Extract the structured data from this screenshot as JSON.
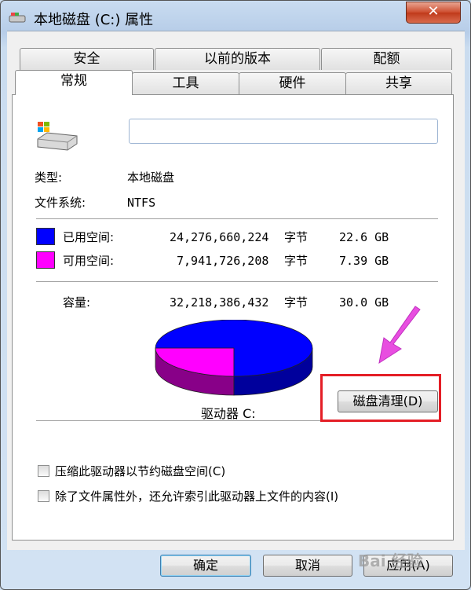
{
  "window": {
    "title": "本地磁盘 (C:) 属性",
    "close_label": "✕"
  },
  "tabs": {
    "row1": [
      "安全",
      "以前的版本",
      "配额"
    ],
    "row2": [
      "常规",
      "工具",
      "硬件",
      "共享"
    ],
    "selected": "常规"
  },
  "general": {
    "name_value": "",
    "type_label": "类型:",
    "type_value": "本地磁盘",
    "fs_label": "文件系统:",
    "fs_value": "NTFS",
    "used": {
      "label": "已用空间:",
      "bytes": "24,276,660,224",
      "unit": "字节",
      "size": "22.6 GB",
      "color": "#0000ff"
    },
    "free": {
      "label": "可用空间:",
      "bytes": "7,941,726,208",
      "unit": "字节",
      "size": "7.39 GB",
      "color": "#ff00ff"
    },
    "capacity": {
      "label": "容量:",
      "bytes": "32,218,386,432",
      "unit": "字节",
      "size": "30.0 GB"
    },
    "drive_label": "驱动器 C:",
    "cleanup_button": "磁盘清理(D)",
    "compress_checkbox": "压缩此驱动器以节约磁盘空间(C)",
    "index_checkbox": "除了文件属性外，还允许索引此驱动器上文件的内容(I)"
  },
  "buttons": {
    "ok": "确定",
    "cancel": "取消",
    "apply": "应用(A)"
  },
  "watermark": "Bai 经验"
}
